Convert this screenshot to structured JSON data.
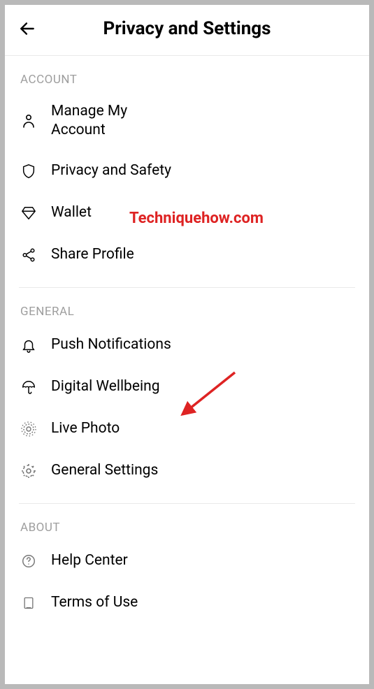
{
  "header": {
    "title": "Privacy and Settings"
  },
  "sections": {
    "account": {
      "header": "ACCOUNT",
      "items": {
        "manage": "Manage My Account",
        "privacy": "Privacy and Safety",
        "wallet": "Wallet",
        "share": "Share Profile"
      }
    },
    "general": {
      "header": "GENERAL",
      "items": {
        "push": "Push Notifications",
        "wellbeing": "Digital Wellbeing",
        "livephoto": "Live Photo",
        "settings": "General Settings"
      }
    },
    "about": {
      "header": "ABOUT",
      "items": {
        "help": "Help Center",
        "terms": "Terms of Use"
      }
    }
  },
  "watermark": "Techniquehow.com"
}
